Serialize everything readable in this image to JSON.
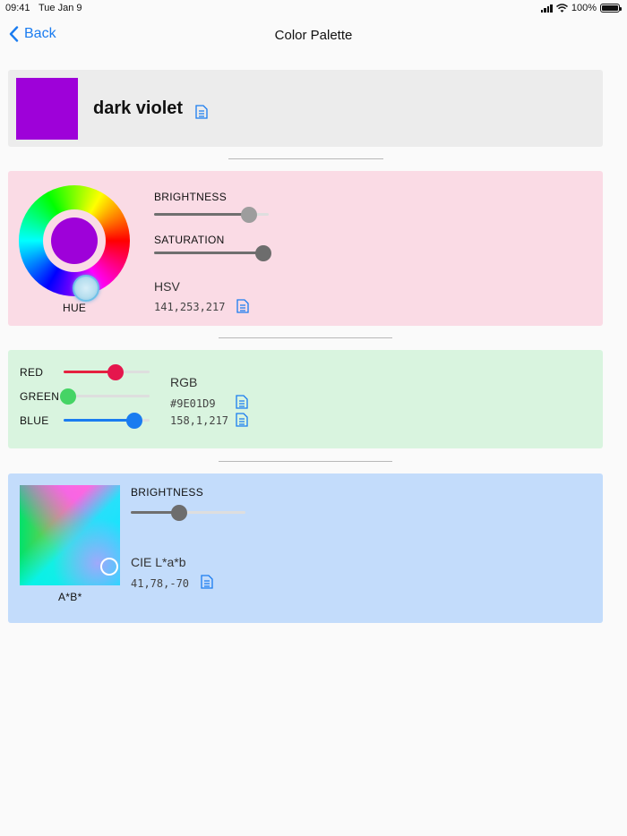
{
  "status": {
    "time": "09:41",
    "date": "Tue Jan 9",
    "battery": "100%",
    "battery_level": 1.0
  },
  "nav": {
    "back_label": "Back",
    "title": "Color Palette"
  },
  "color": {
    "name": "dark violet",
    "hex_color": "#9e01d9"
  },
  "hsv": {
    "brightness_label": "BRIGHTNESS",
    "brightness_value": 0.83,
    "saturation_label": "SATURATION",
    "saturation_value": 0.95,
    "hue_label": "HUE",
    "title": "HSV",
    "value": "141,253,217"
  },
  "rgb": {
    "red_label": "RED",
    "red_value": 0.6,
    "green_label": "GREEN",
    "green_value": 0.05,
    "blue_label": "BLUE",
    "blue_value": 0.82,
    "title": "RGB",
    "hex": "#9E01D9",
    "value": "158,1,217",
    "colors": {
      "red": "#e5213f",
      "green": "#3ed35e",
      "blue": "#1a7cf0"
    }
  },
  "lab": {
    "brightness_label": "BRIGHTNESS",
    "brightness_value": 0.42,
    "plane_label": "A*B*",
    "title": "CIE L*a*b",
    "value": "41,78,-70"
  },
  "colors": {
    "accent": "#1a7cf0",
    "hsv_bg": "#fadbe5",
    "rgb_bg": "#d9f4df",
    "lab_bg": "#c3dcfb"
  },
  "icons": {
    "copy": "document-copy-icon",
    "back": "chevron-left-icon"
  }
}
